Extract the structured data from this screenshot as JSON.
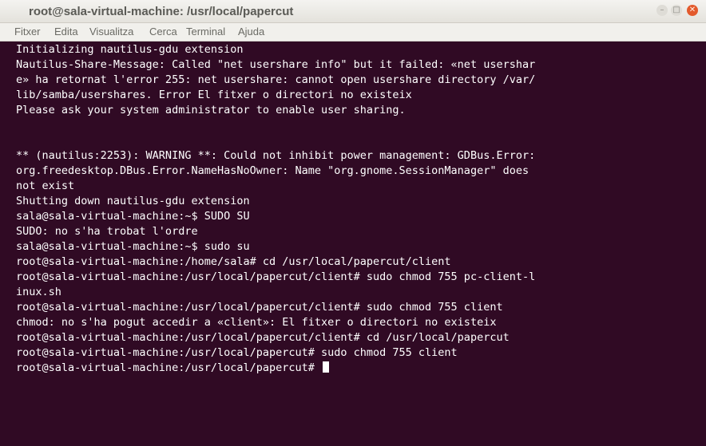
{
  "window": {
    "title": "root@sala-virtual-machine: /usr/local/papercut",
    "controls": {
      "minimize_glyph": "–",
      "maximize_glyph": "□",
      "close_glyph": "✕"
    },
    "close_color": "#e35a2c"
  },
  "menubar": {
    "items": [
      "Fitxer",
      "Edita",
      "Visualitza",
      "Cerca",
      "Terminal",
      "Ajuda"
    ]
  },
  "terminal": {
    "background_color": "#300a24",
    "text_color": "#ffffff",
    "lines": [
      "Initializing nautilus-gdu extension",
      "Nautilus-Share-Message: Called \"net usershare info\" but it failed: «net usershar",
      "e» ha retornat l'error 255: net usershare: cannot open usershare directory /var/",
      "lib/samba/usershares. Error El fitxer o directori no existeix",
      "Please ask your system administrator to enable user sharing.",
      "",
      "",
      "** (nautilus:2253): WARNING **: Could not inhibit power management: GDBus.Error:",
      "org.freedesktop.DBus.Error.NameHasNoOwner: Name \"org.gnome.SessionManager\" does",
      "not exist",
      "Shutting down nautilus-gdu extension",
      "sala@sala-virtual-machine:~$ SUDO SU",
      "SUDO: no s'ha trobat l'ordre",
      "sala@sala-virtual-machine:~$ sudo su",
      "root@sala-virtual-machine:/home/sala# cd /usr/local/papercut/client",
      "root@sala-virtual-machine:/usr/local/papercut/client# sudo chmod 755 pc-client-l",
      "inux.sh",
      "root@sala-virtual-machine:/usr/local/papercut/client# sudo chmod 755 client",
      "chmod: no s'ha pogut accedir a «client»: El fitxer o directori no existeix",
      "root@sala-virtual-machine:/usr/local/papercut/client# cd /usr/local/papercut",
      "root@sala-virtual-machine:/usr/local/papercut# sudo chmod 755 client",
      "root@sala-virtual-machine:/usr/local/papercut# "
    ]
  }
}
